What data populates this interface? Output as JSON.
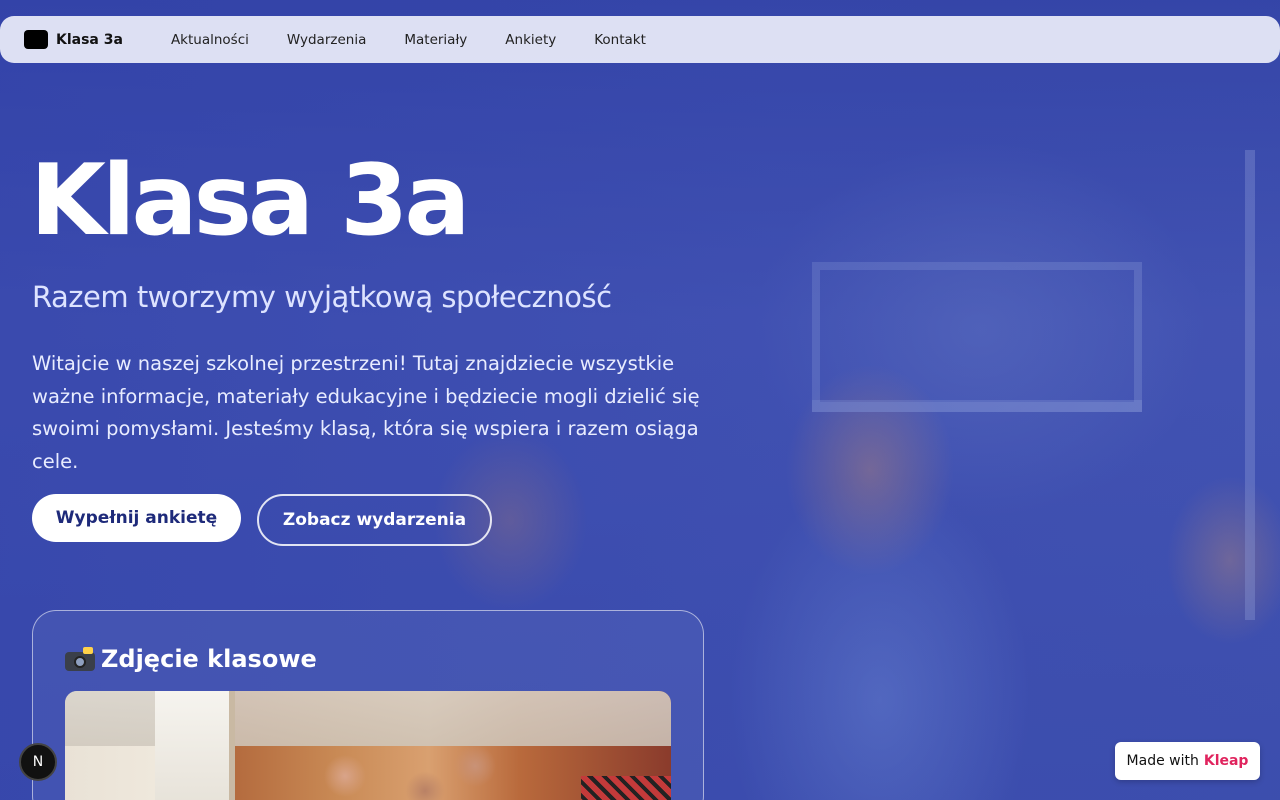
{
  "nav": {
    "brand": "Klasa 3a",
    "links": [
      "Aktualności",
      "Wydarzenia",
      "Materiały",
      "Ankiety",
      "Kontakt"
    ]
  },
  "hero": {
    "title": "Klasa 3a",
    "subtitle": "Razem tworzymy wyjątkową społeczność",
    "text": "Witajcie w naszej szkolnej przestrzeni! Tutaj znajdziecie wszystkie ważne informacje, materiały edukacyjne i będziecie mogli dzielić się swoimi pomysłami. Jesteśmy klasą, która się wspiera i razem osiąga cele.",
    "primary_button": "Wypełnij ankietę",
    "secondary_button": "Zobacz wydarzenia"
  },
  "photo_card": {
    "icon": "camera-icon",
    "title": "Zdjęcie klasowe"
  },
  "badges": {
    "next_letter": "N",
    "made_with_prefix": "Made with",
    "made_with_brand": "Kleap"
  },
  "colors": {
    "background": "#3a4ca6",
    "primary_button_text": "#1e2a7a",
    "kleap_accent": "#e0245e"
  }
}
